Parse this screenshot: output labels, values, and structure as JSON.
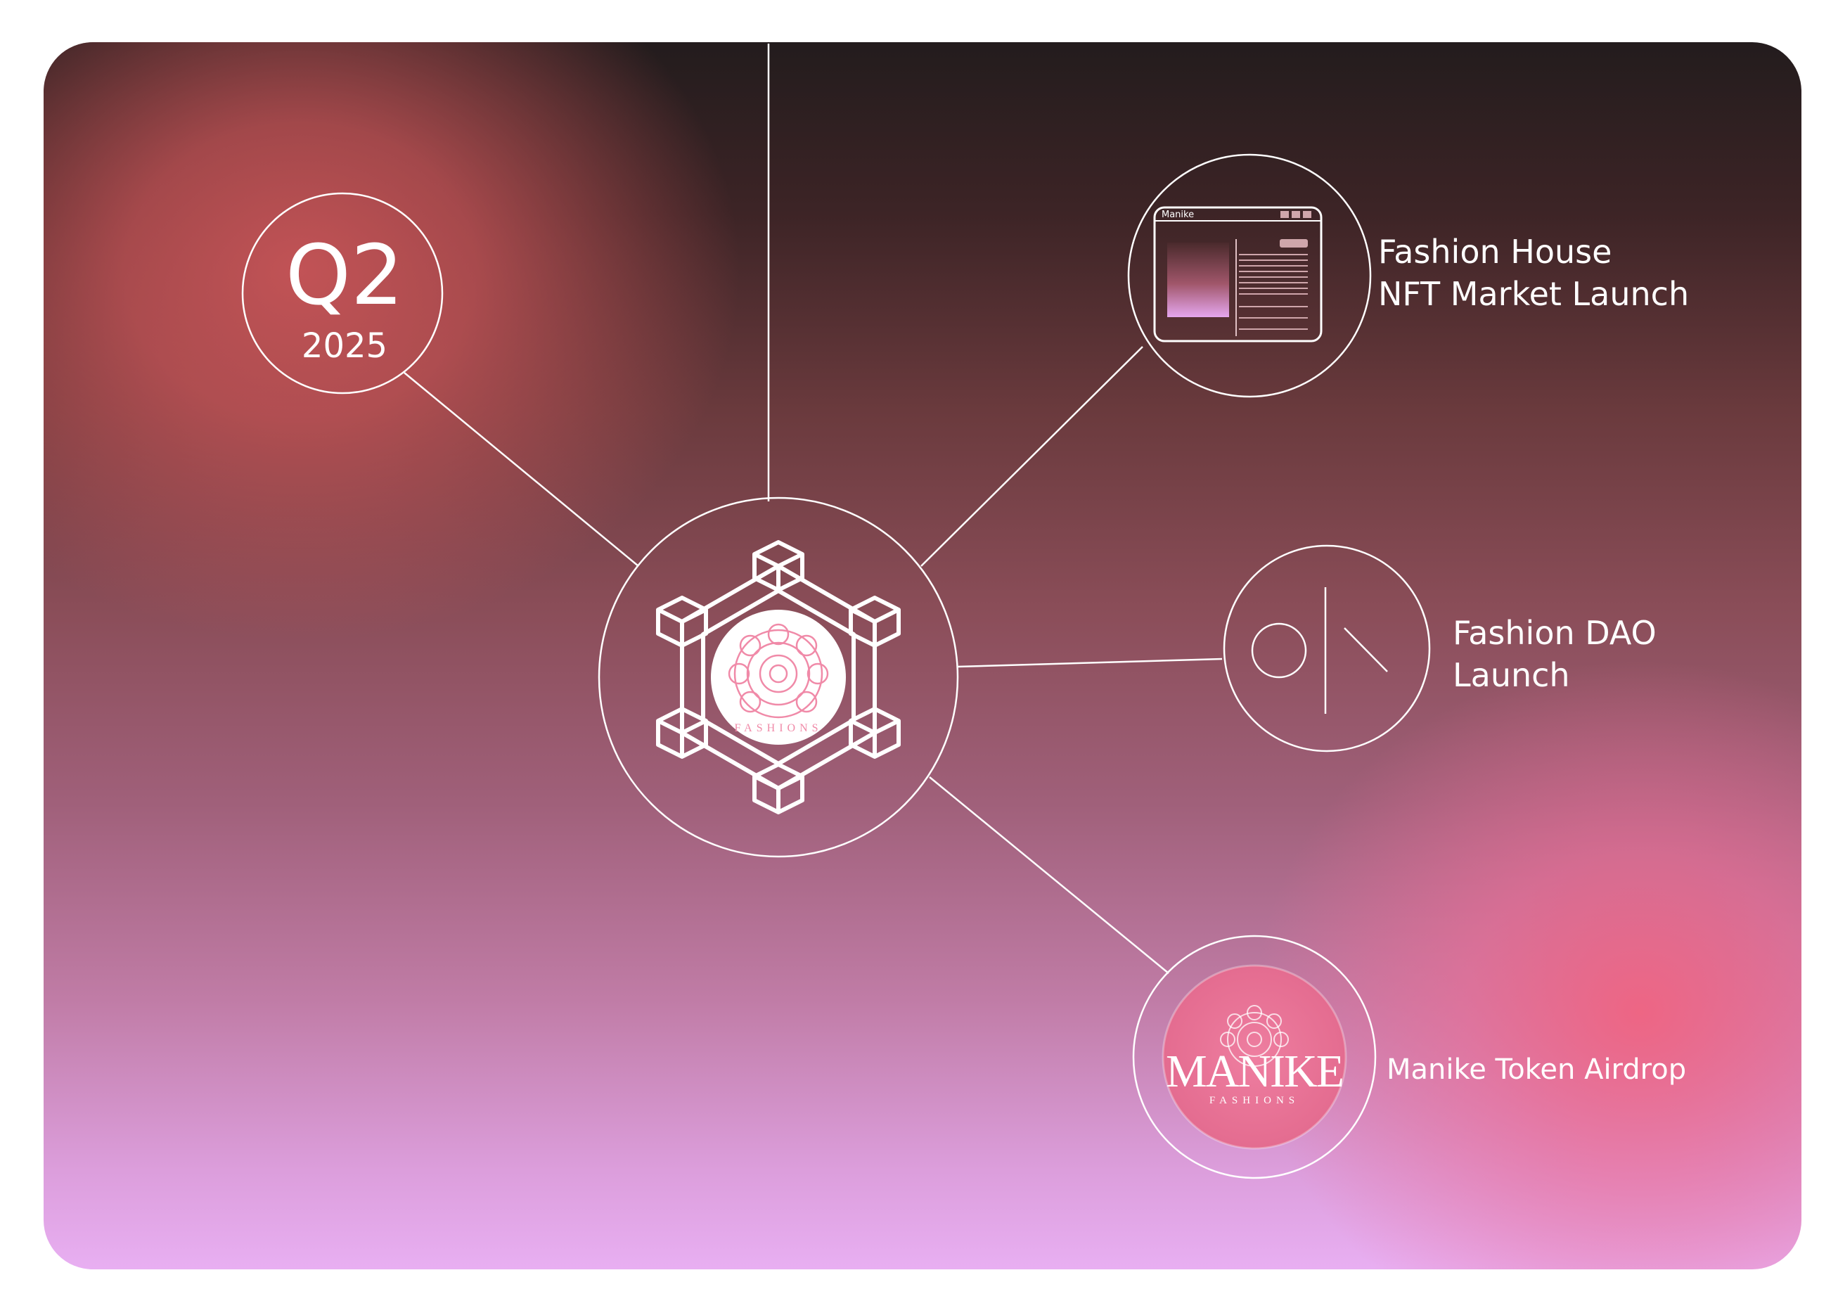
{
  "period": {
    "quarter": "Q2",
    "year": "2025"
  },
  "nodes": [
    {
      "id": "nft-market",
      "label_line1": "Fashion House",
      "label_line2": "NFT Market Launch",
      "icon": "browser-window-icon"
    },
    {
      "id": "dao",
      "label_line1": "Fashion DAO",
      "label_line2": "Launch",
      "icon": "circle-and-slash-icon"
    },
    {
      "id": "airdrop",
      "label_line1": "Manike Token Airdrop",
      "icon": "manike-logo-icon"
    }
  ],
  "center": {
    "icon": "blockchain-hexagon-icon",
    "logo_caption": "FASHIONS"
  },
  "browser_mockup": {
    "title": "Manike"
  },
  "airdrop_logo": {
    "wordmark": "MANIKE",
    "caption": "FASHIONS"
  },
  "colors": {
    "line": "#ffffff",
    "accent_pink": "#e87296",
    "logo_pink": "#f08aa8"
  }
}
